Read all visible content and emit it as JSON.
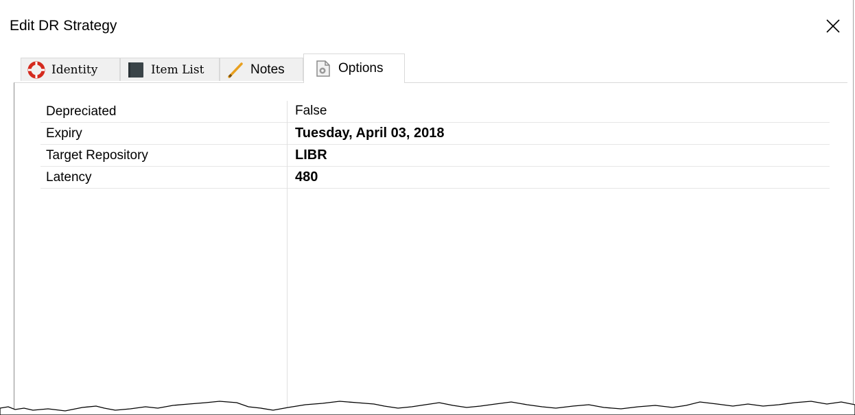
{
  "window": {
    "title": "Edit DR Strategy",
    "close_glyph": "✕"
  },
  "tabs": [
    {
      "label": "Identity",
      "icon": "lifebuoy-icon",
      "icon_color": "#d42a1e",
      "selected": false
    },
    {
      "label": "Item List",
      "icon": "book-icon",
      "icon_color": "#3a4448",
      "selected": false
    },
    {
      "label": "Notes",
      "icon": "pencil-icon",
      "icon_color": "#e8a020",
      "selected": false
    },
    {
      "label": "Options",
      "icon": "settings-document-icon",
      "icon_color": "#8a8a8a",
      "selected": true
    }
  ],
  "properties": [
    {
      "name": "Depreciated",
      "value": "False",
      "bold": false
    },
    {
      "name": "Expiry",
      "value": "Tuesday, April 03, 2018",
      "bold": true
    },
    {
      "name": "Target Repository",
      "value": "LIBR",
      "bold": true
    },
    {
      "name": "Latency",
      "value": "480",
      "bold": true
    }
  ]
}
